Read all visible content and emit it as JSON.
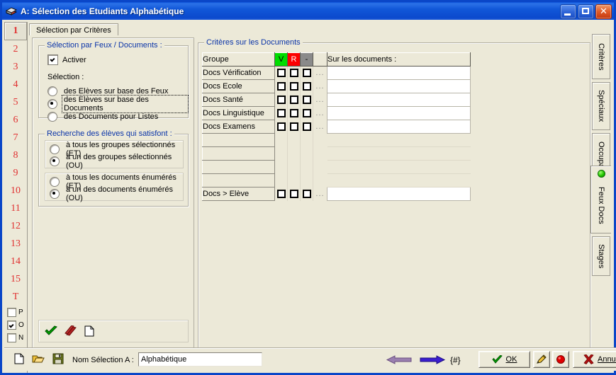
{
  "window": {
    "title": "A: Sélection des Etudiants Alphabétique",
    "icon": "book-icon",
    "minimize": "minimize-icon",
    "maximize": "maximize-icon",
    "close": "close-icon"
  },
  "numstrip": {
    "numbers": [
      "1",
      "2",
      "3",
      "4",
      "5",
      "6",
      "7",
      "8",
      "9",
      "10",
      "11",
      "12",
      "13",
      "14",
      "15",
      "T"
    ],
    "selected": "1",
    "checks": [
      {
        "label": "P",
        "checked": false
      },
      {
        "label": "O",
        "checked": true
      },
      {
        "label": "N",
        "checked": false
      }
    ],
    "doc_icon": "page-icon"
  },
  "tabs": {
    "items": [
      {
        "label": "Sélection par Critères",
        "active": true
      }
    ]
  },
  "left_panel": {
    "group1": {
      "title": "Sélection par Feux / Documents :",
      "activate": {
        "label": "Activer",
        "checked": true
      },
      "selection_label": "Sélection :",
      "options": [
        {
          "label": "des Elèves sur base des Feux",
          "checked": false,
          "focused": false
        },
        {
          "label": "des Elèves sur base des Documents",
          "checked": true,
          "focused": true
        },
        {
          "label": "des Documents pour Listes",
          "checked": false,
          "focused": false
        }
      ]
    },
    "group2": {
      "title": "Recherche des élèves qui satisfont :",
      "group_a": [
        {
          "label": "à tous les groupes sélectionnés (ET)",
          "checked": false
        },
        {
          "label": "à un des groupes sélectionnés (OU)",
          "checked": true
        }
      ],
      "group_b": [
        {
          "label": "à tous les documents énumérés (ET)",
          "checked": false
        },
        {
          "label": "à un des documents énumérés (OU)",
          "checked": true
        }
      ]
    },
    "toolbar": {
      "icons": [
        {
          "name": "green-check-icon",
          "label": "Valider"
        },
        {
          "name": "red-strike-icon",
          "label": "Annuler"
        },
        {
          "name": "page-icon",
          "label": "Nouveau"
        }
      ]
    }
  },
  "criteria": {
    "title": "Critères sur les Documents",
    "columns": [
      {
        "key": "groupe",
        "label": "Groupe",
        "style": "plain"
      },
      {
        "key": "v",
        "label": "V",
        "style": "green"
      },
      {
        "key": "r",
        "label": "R",
        "style": "red"
      },
      {
        "key": "g",
        "label": "-",
        "style": "gray"
      },
      {
        "key": "dots",
        "label": "",
        "style": "plain"
      },
      {
        "key": "docs",
        "label": "Sur les documents :",
        "style": "plain"
      }
    ],
    "rows": [
      {
        "groupe": "Docs Vérification",
        "checks": [
          false,
          false,
          false
        ],
        "dots": "...",
        "docs": "",
        "filled": true
      },
      {
        "groupe": "Docs Ecole",
        "checks": [
          false,
          false,
          false
        ],
        "dots": "...",
        "docs": "",
        "filled": true
      },
      {
        "groupe": "Docs Santé",
        "checks": [
          false,
          false,
          false
        ],
        "dots": "...",
        "docs": "",
        "filled": true
      },
      {
        "groupe": "Docs Linguistique",
        "checks": [
          false,
          false,
          false
        ],
        "dots": "...",
        "docs": "",
        "filled": true
      },
      {
        "groupe": "Docs Examens",
        "checks": [
          false,
          false,
          false
        ],
        "dots": "...",
        "docs": "",
        "filled": true
      },
      {
        "groupe": "",
        "checks": null,
        "dots": "",
        "docs": "",
        "filled": false
      },
      {
        "groupe": "",
        "checks": null,
        "dots": "",
        "docs": "",
        "filled": false
      },
      {
        "groupe": "",
        "checks": null,
        "dots": "",
        "docs": "",
        "filled": false
      },
      {
        "groupe": "",
        "checks": null,
        "dots": "",
        "docs": "",
        "filled": false
      },
      {
        "groupe": "Docs > Elève",
        "checks": [
          false,
          false,
          false
        ],
        "dots": "...",
        "docs": "",
        "filled": true
      }
    ]
  },
  "vertical_tabs": [
    {
      "label": "Critères",
      "active": false,
      "dot": false
    },
    {
      "label": "Spéciaux",
      "active": false,
      "dot": false
    },
    {
      "label": "Occupation",
      "active": false,
      "dot": false
    },
    {
      "label": "Feux Docs",
      "active": true,
      "dot": true
    },
    {
      "label": "Stages",
      "active": false,
      "dot": false
    }
  ],
  "bottom_bar": {
    "file_icons": [
      {
        "name": "new-file-icon"
      },
      {
        "name": "open-folder-icon"
      },
      {
        "name": "save-disk-icon"
      }
    ],
    "name_label": "Nom Sélection A :",
    "name_value": "Alphabétique",
    "prev_arrow": "left-arrow-icon",
    "next_arrow": "right-arrow-icon",
    "hash_label": "{#}",
    "ok_label": "OK",
    "pen_icon": "pen-hand-icon",
    "red_dot_icon": "red-dot-icon",
    "cancel_label": "Annuler"
  },
  "colors": {
    "titlebar": "#0b4ecd",
    "face": "#ece9d8",
    "group_title": "#0a34a8",
    "number_red": "#e03030",
    "green": "#00dd00",
    "red": "#fc0000",
    "gray": "#8a8a8a"
  }
}
